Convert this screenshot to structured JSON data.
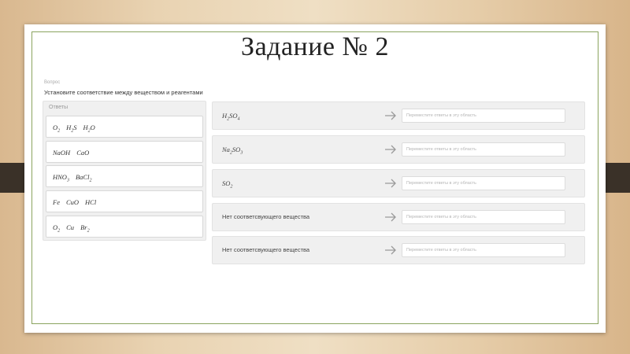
{
  "slide": {
    "title": "Задание № 2"
  },
  "quiz": {
    "question_label": "Вопрос",
    "question_text": "Установите соответствие между веществом и реагентами",
    "answers_label": "Ответы",
    "answers": [
      {
        "parts": [
          [
            "O",
            "2"
          ],
          [
            "H",
            "2",
            "S"
          ],
          [
            "H",
            "2",
            "O"
          ]
        ]
      },
      {
        "parts": [
          [
            "NaOH"
          ],
          [
            "CaO"
          ]
        ]
      },
      {
        "parts": [
          [
            "HNO",
            "3"
          ],
          [
            "BaCl",
            "2"
          ]
        ]
      },
      {
        "parts": [
          [
            "Fe"
          ],
          [
            "CuO"
          ],
          [
            "HCl"
          ]
        ]
      },
      {
        "parts": [
          [
            "O",
            "2"
          ],
          [
            "Cu"
          ],
          [
            "Br",
            "2"
          ]
        ]
      }
    ],
    "targets": [
      {
        "formula": [
          [
            "H",
            "2",
            "SO",
            "4"
          ]
        ],
        "plain": false
      },
      {
        "formula": [
          [
            "Na",
            "2",
            "SO",
            "3"
          ]
        ],
        "plain": false
      },
      {
        "formula": [
          [
            "SO",
            "2"
          ]
        ],
        "plain": false
      },
      {
        "text": "Нет соответсвующего вещества",
        "plain": true
      },
      {
        "text": "Нет соответсвующего вещества",
        "plain": true
      }
    ],
    "drop_placeholder": "Переместите ответы в эту область"
  },
  "colors": {
    "frame": "#8aa35e",
    "band": "#3a3128",
    "panel": "#f0f0f0"
  },
  "icons": {
    "arrow": "arrow-right-icon"
  }
}
